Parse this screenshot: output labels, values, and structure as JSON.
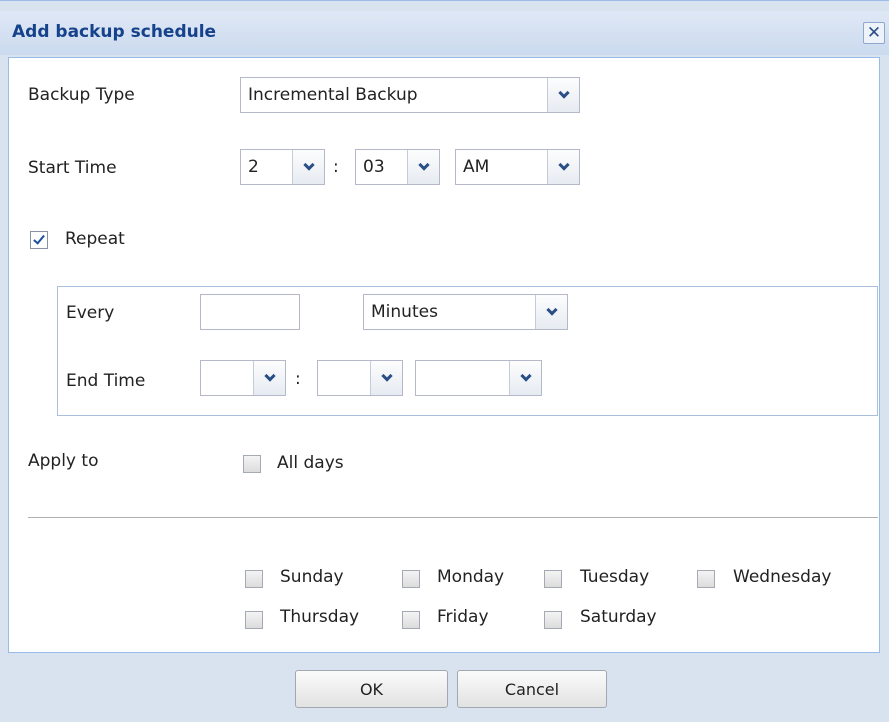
{
  "dialog": {
    "title": "Add backup schedule",
    "close_symbol": "✕"
  },
  "form": {
    "backup_type": {
      "label": "Backup Type",
      "value": "Incremental Backup"
    },
    "start_time": {
      "label": "Start Time",
      "hour": "2",
      "separator": ":",
      "minute": "03",
      "ampm": "AM"
    },
    "repeat": {
      "label": "Repeat",
      "checked": true
    },
    "repeat_box": {
      "every_label": "Every",
      "every_value": "",
      "unit": "Minutes",
      "end_time_label": "End Time",
      "end_hour": "",
      "separator": ":",
      "end_minute": "",
      "end_ampm": ""
    },
    "apply_to": {
      "label": "Apply to",
      "all_days": "All days",
      "days": [
        "Sunday",
        "Monday",
        "Tuesday",
        "Wednesday",
        "Thursday",
        "Friday",
        "Saturday"
      ]
    }
  },
  "buttons": {
    "ok": "OK",
    "cancel": "Cancel"
  },
  "colors": {
    "title": "#15428b",
    "frame": "#d9e3f0",
    "border": "#99bbe8"
  }
}
